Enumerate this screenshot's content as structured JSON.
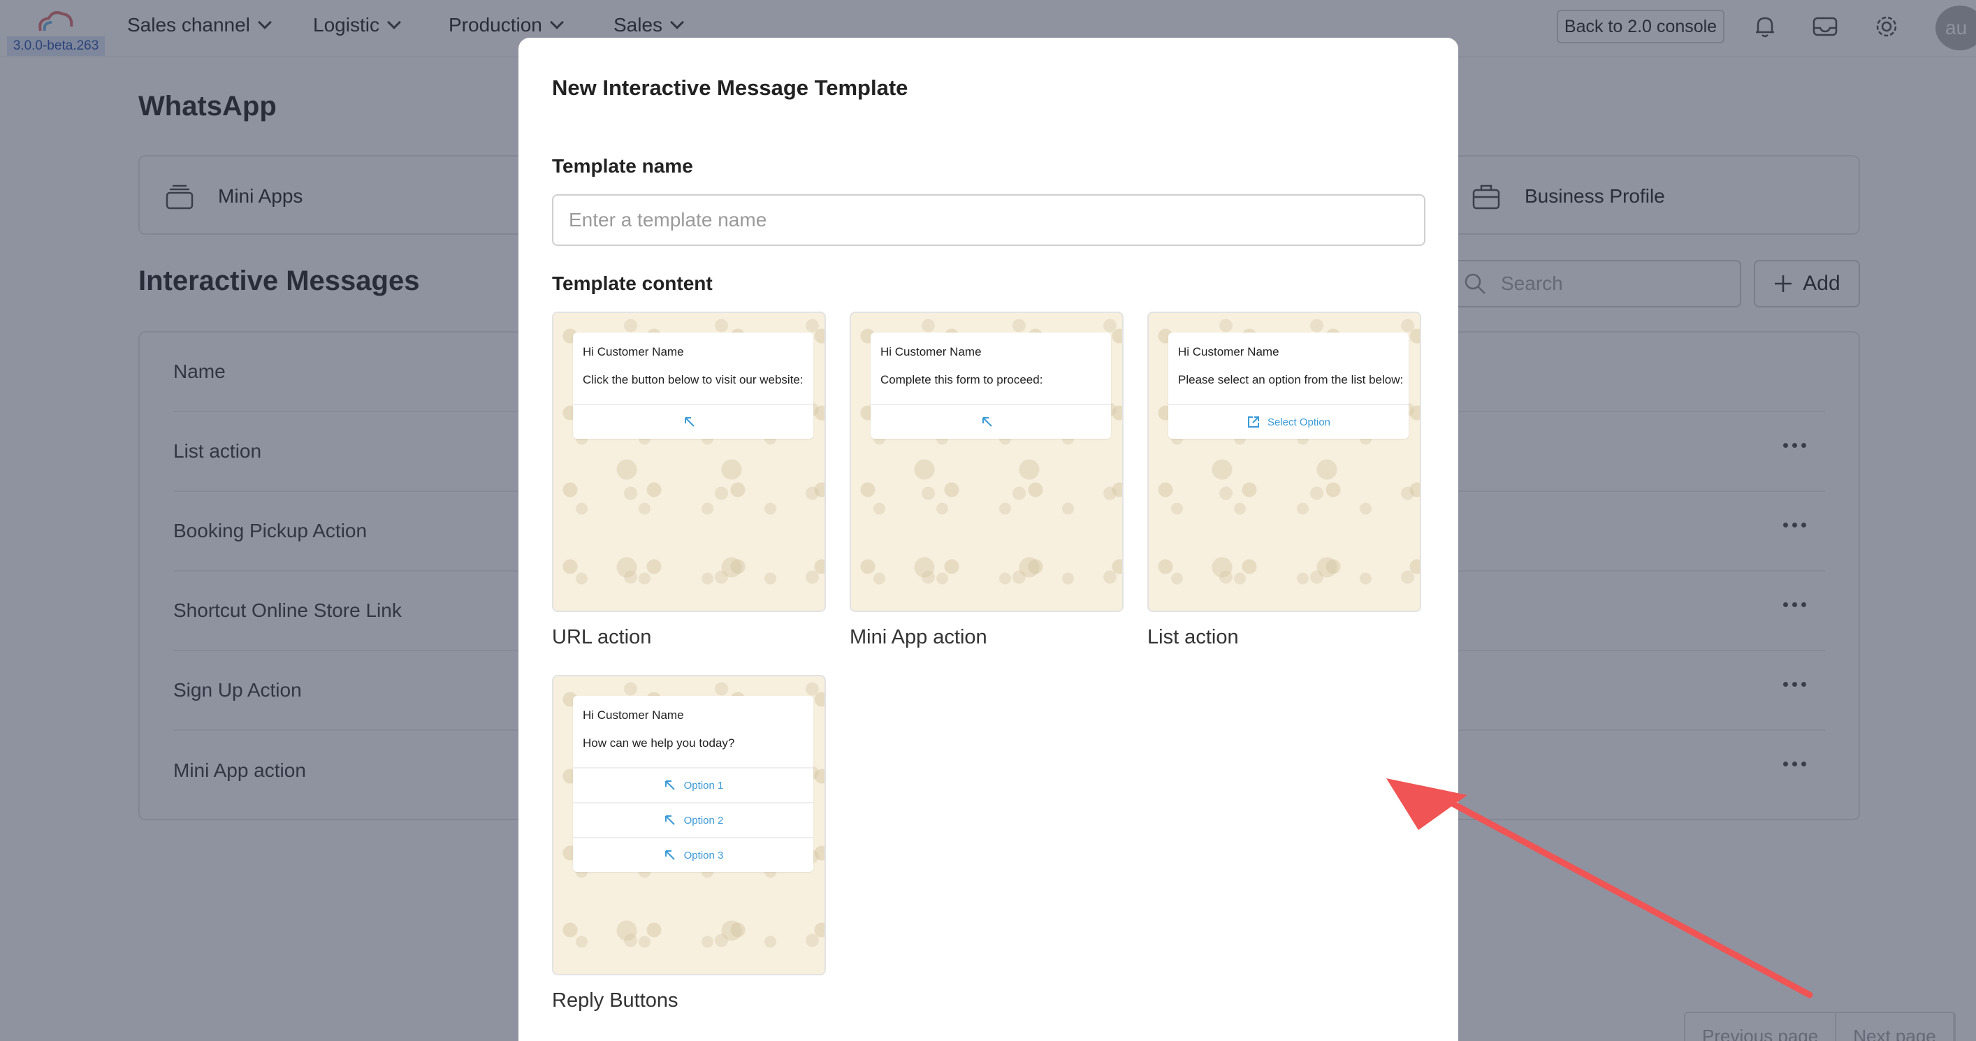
{
  "topbar": {
    "version": "3.0.0-beta.263",
    "nav": [
      "Sales channel",
      "Logistic",
      "Production",
      "Sales"
    ],
    "back_label": "Back to 2.0 console",
    "avatar_initials": "au"
  },
  "page": {
    "title": "WhatsApp",
    "apps": [
      "Mini Apps",
      "Business Profile"
    ],
    "section_title": "Interactive Messages",
    "search_placeholder": "Search",
    "add_label": "Add",
    "list_header": "Name",
    "rows": [
      "List action",
      "Booking Pickup Action",
      "Shortcut Online Store Link",
      "Sign Up Action",
      "Mini App action"
    ],
    "pager": [
      "Previous page",
      "Next page"
    ]
  },
  "modal": {
    "title": "New Interactive Message Template",
    "name_label": "Template name",
    "name_placeholder": "Enter a template name",
    "content_label": "Template content",
    "templates": [
      {
        "label": "URL action",
        "greeting": "Hi Customer Name",
        "body": "Click the button below to visit our website:",
        "buttons": [
          ""
        ]
      },
      {
        "label": "Mini App action",
        "greeting": "Hi Customer Name",
        "body": "Complete this form to proceed:",
        "buttons": [
          ""
        ]
      },
      {
        "label": "List action",
        "greeting": "Hi Customer Name",
        "body": "Please select an option from the list below:",
        "buttons": [
          "Select Option"
        ]
      },
      {
        "label": "Reply Buttons",
        "greeting": "Hi Customer Name",
        "body": "How can we help you today?",
        "buttons": [
          "Option 1",
          "Option 2",
          "Option 3"
        ]
      }
    ]
  },
  "colors": {
    "accent": "#3a9ad6",
    "annotation_arrow": "#f05454",
    "overlay": "#202842"
  }
}
